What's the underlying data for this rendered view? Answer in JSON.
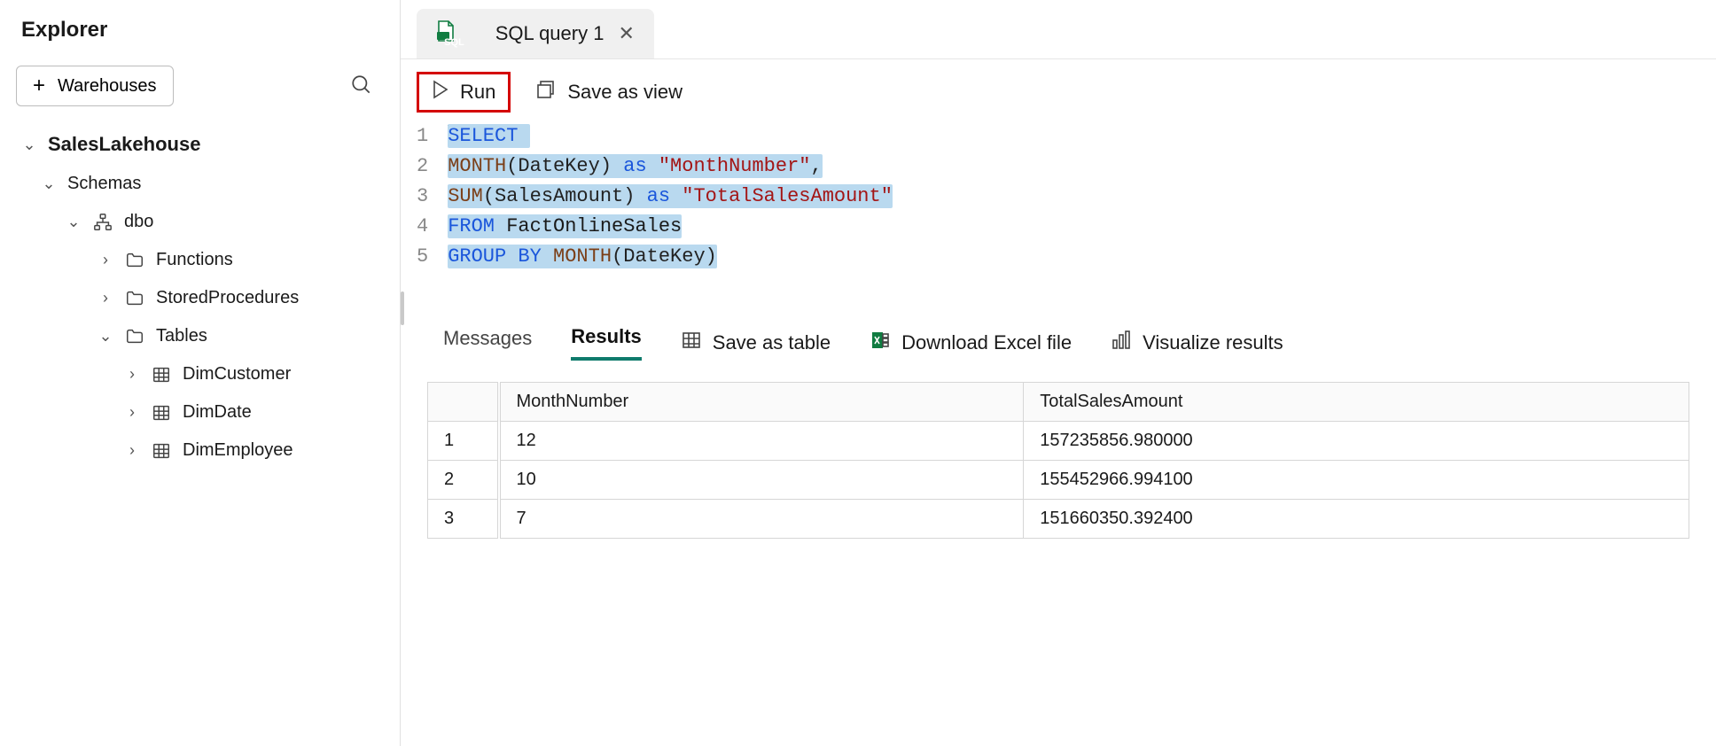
{
  "explorer": {
    "title": "Explorer",
    "add_button": "Warehouses",
    "plus": "+",
    "root": {
      "label": "SalesLakehouse"
    },
    "schemas_label": "Schemas",
    "dbo_label": "dbo",
    "functions_label": "Functions",
    "storedprocs_label": "StoredProcedures",
    "tables_label": "Tables",
    "tables": [
      {
        "label": "DimCustomer"
      },
      {
        "label": "DimDate"
      },
      {
        "label": "DimEmployee"
      }
    ]
  },
  "tab": {
    "badge": "SQL",
    "label": "SQL query 1"
  },
  "toolbar": {
    "run": "Run",
    "save_view": "Save as view"
  },
  "editor": {
    "lines": [
      "1",
      "2",
      "3",
      "4",
      "5"
    ],
    "l1": {
      "select": "SELECT"
    },
    "l2": {
      "month": "MONTH",
      "open": "(DateKey)",
      "as": "as",
      "alias_q": "\"MonthNumber\"",
      "comma": ","
    },
    "l3": {
      "sum": "SUM",
      "open": "(SalesAmount)",
      "as": "as",
      "alias_q": "\"TotalSalesAmount\""
    },
    "l4": {
      "from": "FROM",
      "tbl": "FactOnlineSales"
    },
    "l5": {
      "group": "GROUP",
      "by": "BY",
      "month": "MONTH",
      "open": "(DateKey)"
    }
  },
  "results": {
    "tabs": {
      "messages": "Messages",
      "results": "Results"
    },
    "actions": {
      "save_table": "Save as table",
      "download": "Download Excel file",
      "visualize": "Visualize results"
    },
    "columns": [
      "MonthNumber",
      "TotalSalesAmount"
    ],
    "rows": [
      {
        "n": "1",
        "month": "12",
        "amount": "157235856.980000"
      },
      {
        "n": "2",
        "month": "10",
        "amount": "155452966.994100"
      },
      {
        "n": "3",
        "month": "7",
        "amount": "151660350.392400"
      }
    ]
  }
}
